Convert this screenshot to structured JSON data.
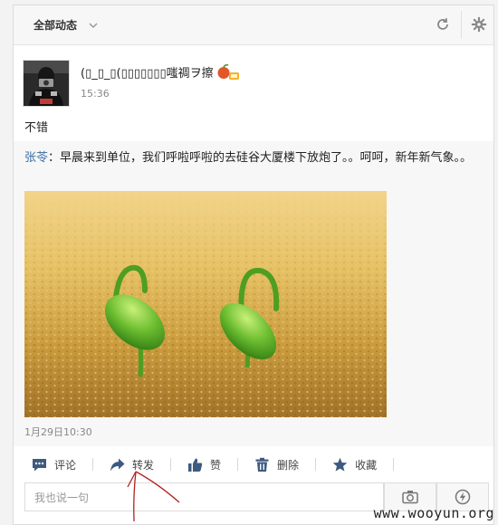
{
  "header": {
    "filter_label": "全部动态",
    "icons": [
      "chevron-down-icon",
      "refresh-icon",
      "gear-icon"
    ]
  },
  "post": {
    "author": "(▯_▯_▯(▯▯▯▯▯▯▯嗤禂ヲ擦",
    "time": "15:36",
    "comment": "不错"
  },
  "quote": {
    "author": "张苓",
    "separator": "：",
    "text": "早晨来到单位，我们呼啦呼啦的去硅谷大厦楼下放炮了。。呵呵，新年新气象。。",
    "date": "1月29日10:30"
  },
  "actions": [
    {
      "label": "评论",
      "icon": "comment-icon"
    },
    {
      "label": "转发",
      "icon": "forward-icon"
    },
    {
      "label": "赞",
      "icon": "like-icon"
    },
    {
      "label": "删除",
      "icon": "trash-icon"
    },
    {
      "label": "收藏",
      "icon": "star-icon"
    }
  ],
  "reply": {
    "placeholder": "我也说一句"
  },
  "watermark": "www.wooyun.org",
  "colors": {
    "link": "#3a6ea5",
    "icon": "#3d5a80",
    "annotation": "#b22222"
  }
}
